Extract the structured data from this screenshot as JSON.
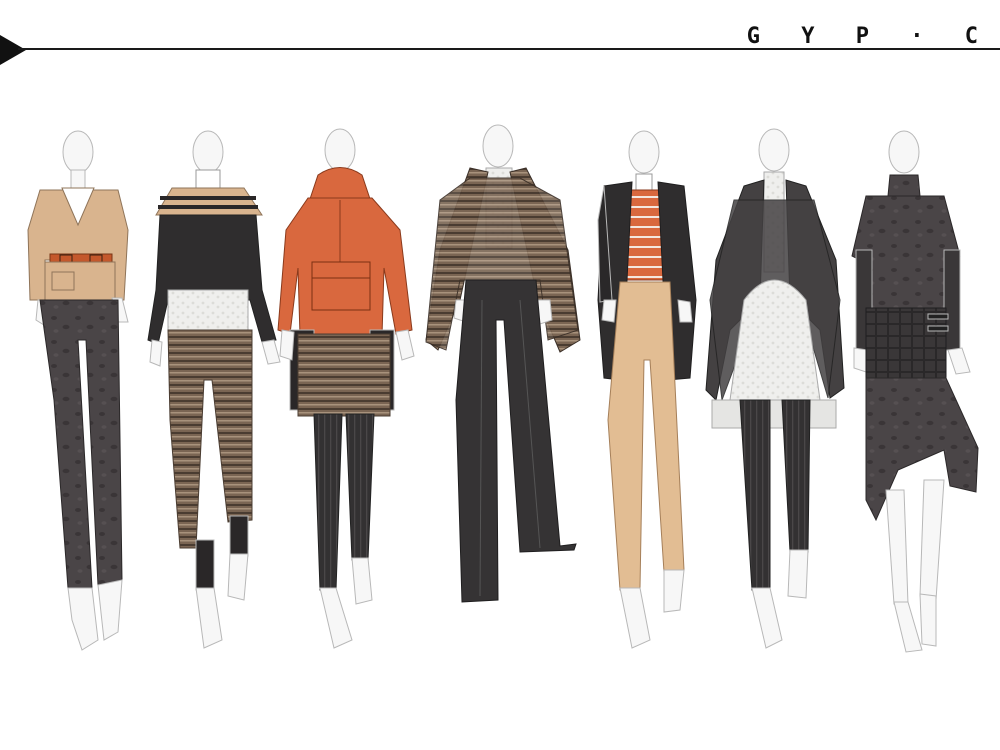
{
  "brand": {
    "name": "G Y P · C"
  },
  "colors": {
    "skin": "#f7f7f7",
    "outline": "#b8b8b8",
    "camel": "#d9b48e",
    "charcoal": "#3f3c3d",
    "dark": "#2d2b2c",
    "rust": "#d9683e",
    "stripe_brown": "#6e5a48",
    "white": "#f2f2f0",
    "leopard": "#4a4547",
    "tan_leg": "#e2bd93"
  },
  "figures": [
    {
      "id": 1,
      "top": "camel-belted-jacket",
      "bottom": "charcoal-leopard-trousers"
    },
    {
      "id": 2,
      "top": "striped-cape-sweater",
      "bottom": "striped-tweed-pants"
    },
    {
      "id": 3,
      "top": "rust-hooded-anorak",
      "bottom": "striped-shorts-ribbed-leggings"
    },
    {
      "id": 4,
      "top": "striped-blanket-cape",
      "bottom": "charcoal-wide-trousers"
    },
    {
      "id": 5,
      "top": "dark-coat-rust-striped-knit",
      "bottom": "tan-leggings"
    },
    {
      "id": 6,
      "top": "draped-charcoal-cardigan",
      "bottom": "ribbed-leggings"
    },
    {
      "id": 7,
      "top": "leopard-short-sleeve-top",
      "bottom": "quilted-wrap-skirt"
    }
  ]
}
